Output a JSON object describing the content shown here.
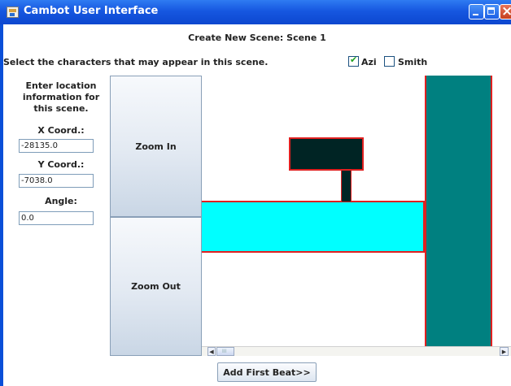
{
  "window": {
    "title": "Cambot User Interface"
  },
  "scene": {
    "heading": "Create New Scene: Scene 1"
  },
  "characters": {
    "prompt": "Select the characters that may appear in this scene.",
    "options": [
      {
        "label": "Azi",
        "checked": true
      },
      {
        "label": "Smith",
        "checked": false
      }
    ]
  },
  "location": {
    "prompt": "Enter location information for this scene.",
    "x_label": "X Coord.:",
    "x_value": "-28135.0",
    "y_label": "Y Coord.:",
    "y_value": "-7038.0",
    "angle_label": "Angle:",
    "angle_value": "0.0"
  },
  "zoom": {
    "in_label": "Zoom In",
    "out_label": "Zoom Out"
  },
  "actions": {
    "add_beat_label": "Add First Beat>>"
  },
  "colors": {
    "title_bar": "#1657e0",
    "map_wall": "#008080",
    "map_corridor": "#00ffff",
    "map_object": "#002424",
    "map_outline": "#e02020"
  }
}
